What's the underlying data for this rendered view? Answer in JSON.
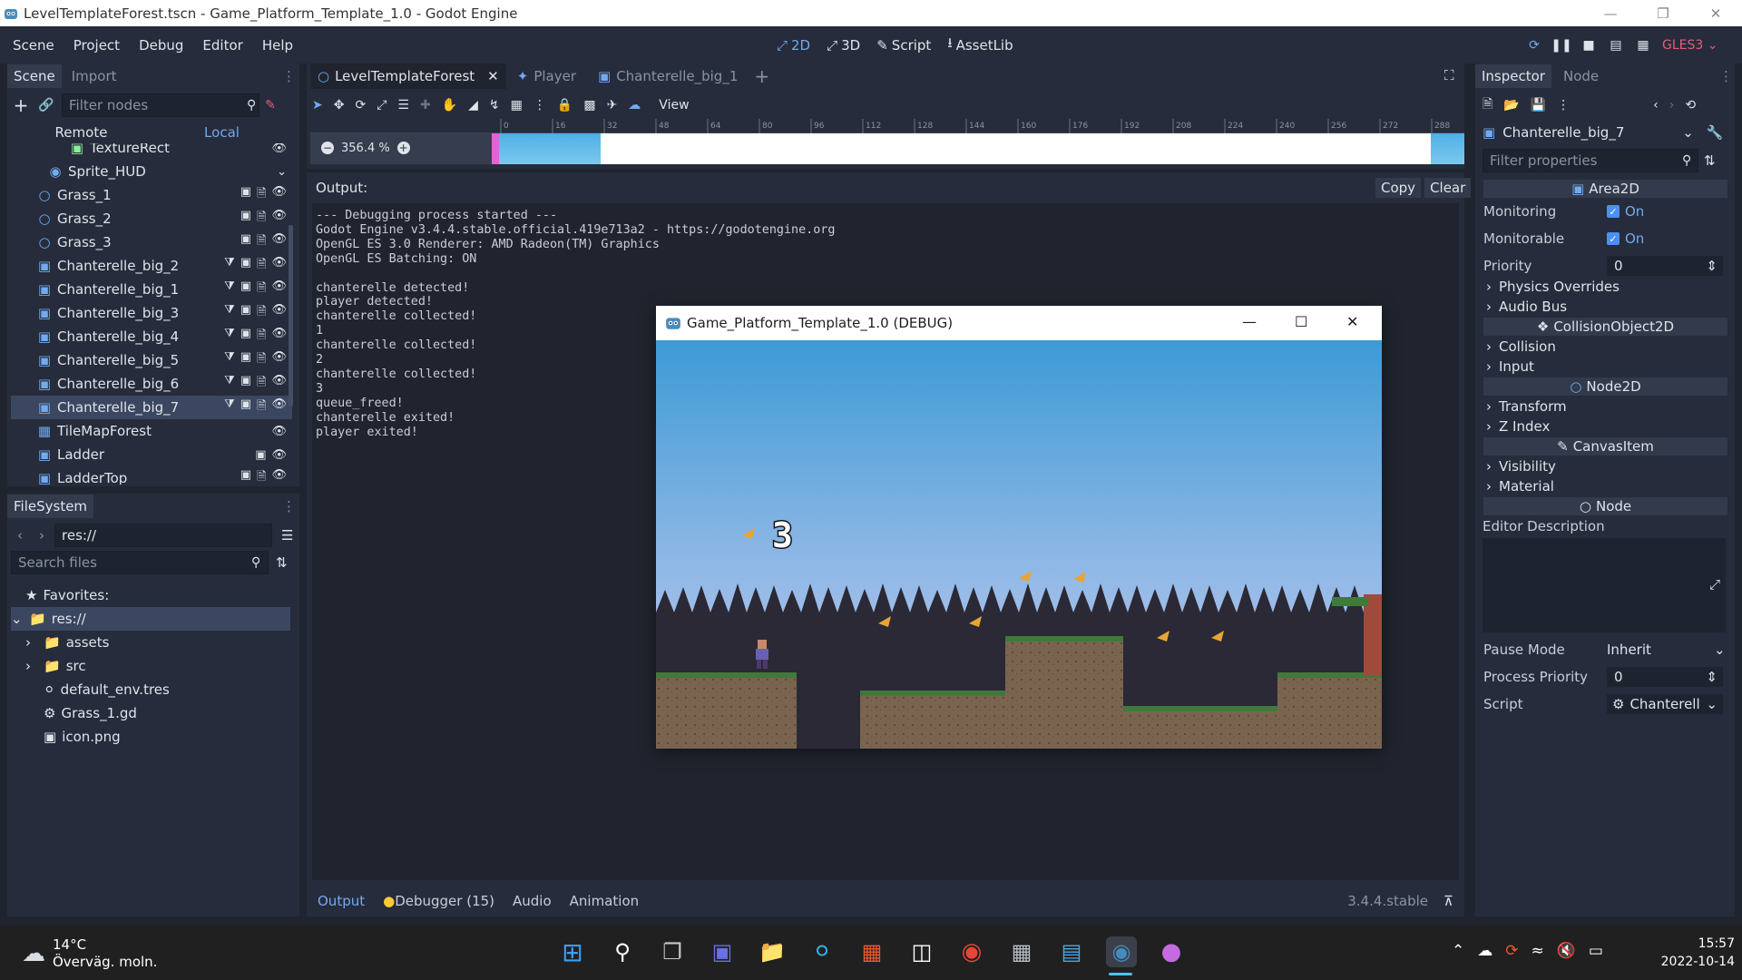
{
  "window": {
    "title": "LevelTemplateForest.tscn - Game_Platform_Template_1.0 - Godot Engine"
  },
  "menu": [
    "Scene",
    "Project",
    "Debug",
    "Editor",
    "Help"
  ],
  "workspaces": {
    "w2d": "2D",
    "w3d": "3D",
    "script": "Script",
    "assetlib": "AssetLib"
  },
  "renderer": "GLES3",
  "scene_dock": {
    "tabs": [
      "Scene",
      "Import"
    ],
    "filter_placeholder": "Filter nodes",
    "remote": "Remote",
    "local": "Local",
    "nodes": [
      {
        "label": "TextureRect",
        "icon": "texture-rect-icon"
      },
      {
        "label": "Sprite_HUD",
        "icon": "sprite-icon"
      },
      {
        "label": "Grass_1",
        "icon": "node2d-icon"
      },
      {
        "label": "Grass_2",
        "icon": "node2d-icon"
      },
      {
        "label": "Grass_3",
        "icon": "node2d-icon"
      },
      {
        "label": "Chanterelle_big_2",
        "icon": "area2d-icon"
      },
      {
        "label": "Chanterelle_big_1",
        "icon": "area2d-icon"
      },
      {
        "label": "Chanterelle_big_3",
        "icon": "area2d-icon"
      },
      {
        "label": "Chanterelle_big_4",
        "icon": "area2d-icon"
      },
      {
        "label": "Chanterelle_big_5",
        "icon": "area2d-icon"
      },
      {
        "label": "Chanterelle_big_6",
        "icon": "area2d-icon"
      },
      {
        "label": "Chanterelle_big_7",
        "icon": "area2d-icon"
      },
      {
        "label": "TileMapForest",
        "icon": "tilemap-icon"
      },
      {
        "label": "Ladder",
        "icon": "area2d-icon"
      },
      {
        "label": "LadderTop",
        "icon": "area2d-icon"
      }
    ]
  },
  "filesystem": {
    "tab": "FileSystem",
    "path": "res://",
    "search_placeholder": "Search files",
    "favorites": "Favorites:",
    "items": [
      {
        "label": "res://",
        "icon": "folder-icon"
      },
      {
        "label": "assets",
        "icon": "folder-icon"
      },
      {
        "label": "src",
        "icon": "folder-icon"
      },
      {
        "label": "default_env.tres",
        "icon": "environment-icon"
      },
      {
        "label": "Grass_1.gd",
        "icon": "gear-icon"
      },
      {
        "label": "icon.png",
        "icon": "image-icon"
      }
    ]
  },
  "editor_tabs": [
    "LevelTemplateForest",
    "Player",
    "Chanterelle_big_1"
  ],
  "toolbar": {
    "view": "View"
  },
  "zoom": "356.4 %",
  "ruler_ticks": [
    "0",
    "16",
    "32",
    "48",
    "64",
    "80",
    "96",
    "112",
    "128",
    "144",
    "160",
    "176",
    "192",
    "208",
    "224",
    "240",
    "256",
    "272",
    "288"
  ],
  "output": {
    "label": "Output:",
    "copy": "Copy",
    "clear": "Clear",
    "lines": [
      "--- Debugging process started ---",
      "Godot Engine v3.4.4.stable.official.419e713a2 - https://godotengine.org",
      "OpenGL ES 3.0 Renderer: AMD Radeon(TM) Graphics",
      "OpenGL ES Batching: ON",
      "",
      "chanterelle detected!",
      "player detected!",
      "chanterelle collected!",
      "1",
      "chanterelle collected!",
      "2",
      "chanterelle collected!",
      "3",
      "queue_freed!",
      "chanterelle exited!",
      "player exited!"
    ]
  },
  "bottom_tabs": {
    "output": "Output",
    "debugger": "Debugger (15)",
    "audio": "Audio",
    "animation": "Animation"
  },
  "version": "3.4.4.stable",
  "inspector": {
    "tabs": [
      "Inspector",
      "Node"
    ],
    "object": "Chanterelle_big_7",
    "filter_placeholder": "Filter properties",
    "area2d": "Area2D",
    "monitoring": {
      "label": "Monitoring",
      "value": "On"
    },
    "monitorable": {
      "label": "Monitorable",
      "value": "On"
    },
    "priority": {
      "label": "Priority",
      "value": "0"
    },
    "physics_overrides": "Physics Overrides",
    "audio_bus": "Audio Bus",
    "collision_object": "CollisionObject2D",
    "collision": "Collision",
    "input": "Input",
    "node2d": "Node2D",
    "transform": "Transform",
    "z_index": "Z Index",
    "canvas_item": "CanvasItem",
    "visibility": "Visibility",
    "material": "Material",
    "node": "Node",
    "editor_description": "Editor Description",
    "pause_mode": {
      "label": "Pause Mode",
      "value": "Inherit"
    },
    "process_priority": {
      "label": "Process Priority",
      "value": "0"
    },
    "script": {
      "label": "Script",
      "value": "Chanterell"
    }
  },
  "game_window": {
    "title": "Game_Platform_Template_1.0 (DEBUG)",
    "counter": "3"
  },
  "taskbar": {
    "temp": "14°C",
    "weather": "Överväg. moln.",
    "time": "15:57",
    "date": "2022-10-14"
  },
  "colors": {
    "accent": "#72aaf0",
    "panel": "#262c3b",
    "background": "#1f242e",
    "sky_top": "#3d9ad6",
    "sky_bottom": "#c6c8ed"
  }
}
